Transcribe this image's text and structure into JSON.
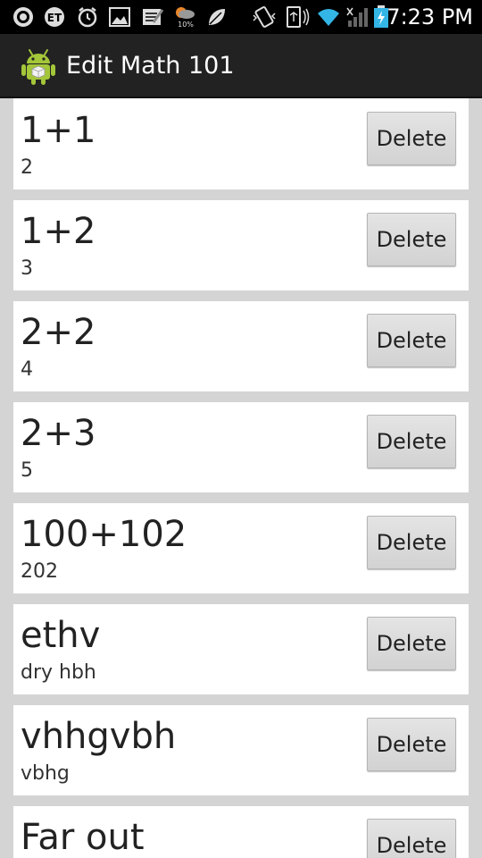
{
  "status_bar": {
    "time": "7:23 PM",
    "icons": [
      "record-icon",
      "et-icon",
      "alarm-icon",
      "gallery-icon",
      "notes-icon",
      "weather-icon",
      "leaf-icon",
      "vibrate-icon",
      "nfc-icon",
      "wifi-icon",
      "signal-icon",
      "battery-charging-icon"
    ],
    "weather_label": "10%"
  },
  "action_bar": {
    "title": "Edit Math 101",
    "icon": "android-icon"
  },
  "cards": [
    {
      "question": "1+1",
      "answer": "2",
      "delete_label": "Delete"
    },
    {
      "question": "1+2",
      "answer": "3",
      "delete_label": "Delete"
    },
    {
      "question": "2+2",
      "answer": "4",
      "delete_label": "Delete"
    },
    {
      "question": "2+3",
      "answer": "5",
      "delete_label": "Delete"
    },
    {
      "question": "100+102",
      "answer": "202",
      "delete_label": "Delete"
    },
    {
      "question": "ethv",
      "answer": "dry hbh",
      "delete_label": "Delete"
    },
    {
      "question": "vhhgvbh",
      "answer": "vbhg",
      "delete_label": "Delete"
    },
    {
      "question": "Far out",
      "answer": "",
      "delete_label": "Delete"
    }
  ],
  "colors": {
    "background": "#d4d4d4",
    "action_bar": "#222222",
    "status_bar": "#000000",
    "card": "#ffffff",
    "android_green": "#a4c639",
    "wifi_blue": "#33b5e5"
  }
}
